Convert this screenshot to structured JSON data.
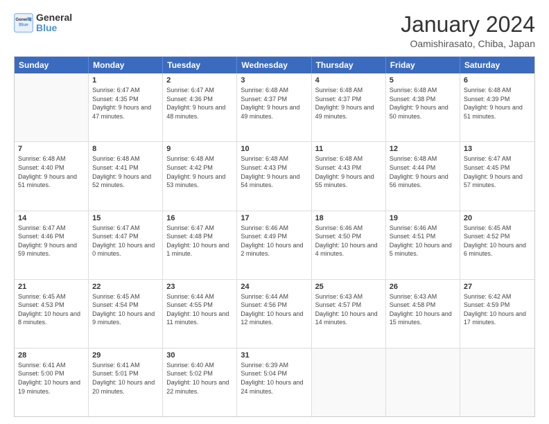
{
  "logo": {
    "line1": "General",
    "line2": "Blue"
  },
  "title": "January 2024",
  "subtitle": "Oamishirasato, Chiba, Japan",
  "days": [
    "Sunday",
    "Monday",
    "Tuesday",
    "Wednesday",
    "Thursday",
    "Friday",
    "Saturday"
  ],
  "weeks": [
    [
      {
        "day": "",
        "empty": true
      },
      {
        "day": "1",
        "sunrise": "Sunrise: 6:47 AM",
        "sunset": "Sunset: 4:35 PM",
        "daylight": "Daylight: 9 hours and 47 minutes."
      },
      {
        "day": "2",
        "sunrise": "Sunrise: 6:47 AM",
        "sunset": "Sunset: 4:36 PM",
        "daylight": "Daylight: 9 hours and 48 minutes."
      },
      {
        "day": "3",
        "sunrise": "Sunrise: 6:48 AM",
        "sunset": "Sunset: 4:37 PM",
        "daylight": "Daylight: 9 hours and 49 minutes."
      },
      {
        "day": "4",
        "sunrise": "Sunrise: 6:48 AM",
        "sunset": "Sunset: 4:37 PM",
        "daylight": "Daylight: 9 hours and 49 minutes."
      },
      {
        "day": "5",
        "sunrise": "Sunrise: 6:48 AM",
        "sunset": "Sunset: 4:38 PM",
        "daylight": "Daylight: 9 hours and 50 minutes."
      },
      {
        "day": "6",
        "sunrise": "Sunrise: 6:48 AM",
        "sunset": "Sunset: 4:39 PM",
        "daylight": "Daylight: 9 hours and 51 minutes."
      }
    ],
    [
      {
        "day": "7",
        "sunrise": "Sunrise: 6:48 AM",
        "sunset": "Sunset: 4:40 PM",
        "daylight": "Daylight: 9 hours and 51 minutes."
      },
      {
        "day": "8",
        "sunrise": "Sunrise: 6:48 AM",
        "sunset": "Sunset: 4:41 PM",
        "daylight": "Daylight: 9 hours and 52 minutes."
      },
      {
        "day": "9",
        "sunrise": "Sunrise: 6:48 AM",
        "sunset": "Sunset: 4:42 PM",
        "daylight": "Daylight: 9 hours and 53 minutes."
      },
      {
        "day": "10",
        "sunrise": "Sunrise: 6:48 AM",
        "sunset": "Sunset: 4:43 PM",
        "daylight": "Daylight: 9 hours and 54 minutes."
      },
      {
        "day": "11",
        "sunrise": "Sunrise: 6:48 AM",
        "sunset": "Sunset: 4:43 PM",
        "daylight": "Daylight: 9 hours and 55 minutes."
      },
      {
        "day": "12",
        "sunrise": "Sunrise: 6:48 AM",
        "sunset": "Sunset: 4:44 PM",
        "daylight": "Daylight: 9 hours and 56 minutes."
      },
      {
        "day": "13",
        "sunrise": "Sunrise: 6:47 AM",
        "sunset": "Sunset: 4:45 PM",
        "daylight": "Daylight: 9 hours and 57 minutes."
      }
    ],
    [
      {
        "day": "14",
        "sunrise": "Sunrise: 6:47 AM",
        "sunset": "Sunset: 4:46 PM",
        "daylight": "Daylight: 9 hours and 59 minutes."
      },
      {
        "day": "15",
        "sunrise": "Sunrise: 6:47 AM",
        "sunset": "Sunset: 4:47 PM",
        "daylight": "Daylight: 10 hours and 0 minutes."
      },
      {
        "day": "16",
        "sunrise": "Sunrise: 6:47 AM",
        "sunset": "Sunset: 4:48 PM",
        "daylight": "Daylight: 10 hours and 1 minute."
      },
      {
        "day": "17",
        "sunrise": "Sunrise: 6:46 AM",
        "sunset": "Sunset: 4:49 PM",
        "daylight": "Daylight: 10 hours and 2 minutes."
      },
      {
        "day": "18",
        "sunrise": "Sunrise: 6:46 AM",
        "sunset": "Sunset: 4:50 PM",
        "daylight": "Daylight: 10 hours and 4 minutes."
      },
      {
        "day": "19",
        "sunrise": "Sunrise: 6:46 AM",
        "sunset": "Sunset: 4:51 PM",
        "daylight": "Daylight: 10 hours and 5 minutes."
      },
      {
        "day": "20",
        "sunrise": "Sunrise: 6:45 AM",
        "sunset": "Sunset: 4:52 PM",
        "daylight": "Daylight: 10 hours and 6 minutes."
      }
    ],
    [
      {
        "day": "21",
        "sunrise": "Sunrise: 6:45 AM",
        "sunset": "Sunset: 4:53 PM",
        "daylight": "Daylight: 10 hours and 8 minutes."
      },
      {
        "day": "22",
        "sunrise": "Sunrise: 6:45 AM",
        "sunset": "Sunset: 4:54 PM",
        "daylight": "Daylight: 10 hours and 9 minutes."
      },
      {
        "day": "23",
        "sunrise": "Sunrise: 6:44 AM",
        "sunset": "Sunset: 4:55 PM",
        "daylight": "Daylight: 10 hours and 11 minutes."
      },
      {
        "day": "24",
        "sunrise": "Sunrise: 6:44 AM",
        "sunset": "Sunset: 4:56 PM",
        "daylight": "Daylight: 10 hours and 12 minutes."
      },
      {
        "day": "25",
        "sunrise": "Sunrise: 6:43 AM",
        "sunset": "Sunset: 4:57 PM",
        "daylight": "Daylight: 10 hours and 14 minutes."
      },
      {
        "day": "26",
        "sunrise": "Sunrise: 6:43 AM",
        "sunset": "Sunset: 4:58 PM",
        "daylight": "Daylight: 10 hours and 15 minutes."
      },
      {
        "day": "27",
        "sunrise": "Sunrise: 6:42 AM",
        "sunset": "Sunset: 4:59 PM",
        "daylight": "Daylight: 10 hours and 17 minutes."
      }
    ],
    [
      {
        "day": "28",
        "sunrise": "Sunrise: 6:41 AM",
        "sunset": "Sunset: 5:00 PM",
        "daylight": "Daylight: 10 hours and 19 minutes."
      },
      {
        "day": "29",
        "sunrise": "Sunrise: 6:41 AM",
        "sunset": "Sunset: 5:01 PM",
        "daylight": "Daylight: 10 hours and 20 minutes."
      },
      {
        "day": "30",
        "sunrise": "Sunrise: 6:40 AM",
        "sunset": "Sunset: 5:02 PM",
        "daylight": "Daylight: 10 hours and 22 minutes."
      },
      {
        "day": "31",
        "sunrise": "Sunrise: 6:39 AM",
        "sunset": "Sunset: 5:04 PM",
        "daylight": "Daylight: 10 hours and 24 minutes."
      },
      {
        "day": "",
        "empty": true
      },
      {
        "day": "",
        "empty": true
      },
      {
        "day": "",
        "empty": true
      }
    ]
  ]
}
